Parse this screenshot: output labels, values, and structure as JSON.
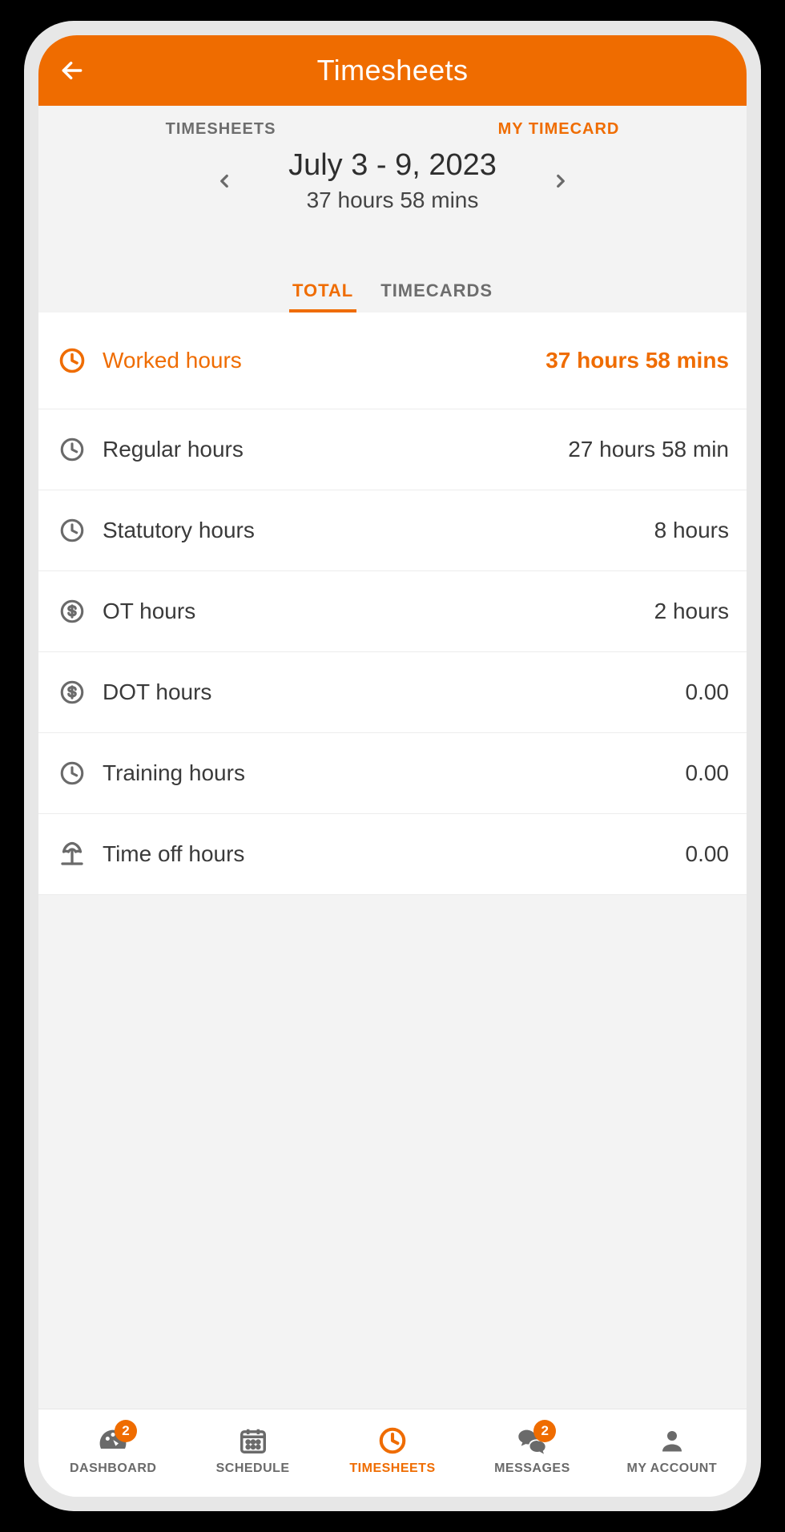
{
  "header": {
    "title": "Timesheets"
  },
  "top_tabs": {
    "timesheets": "TIMESHEETS",
    "my_timecard": "MY TIMECARD"
  },
  "date": {
    "range": "July 3 - 9, 2023",
    "summary": "37 hours 58 mins"
  },
  "subtabs": {
    "total": "TOTAL",
    "timecards": "TIMECARDS"
  },
  "rows": {
    "worked": {
      "label": "Worked hours",
      "value": "37 hours 58 mins"
    },
    "regular": {
      "label": "Regular hours",
      "value": "27 hours 58 min"
    },
    "statutory": {
      "label": "Statutory hours",
      "value": "8 hours"
    },
    "ot": {
      "label": "OT hours",
      "value": "2 hours"
    },
    "dot": {
      "label": "DOT hours",
      "value": "0.00"
    },
    "training": {
      "label": "Training hours",
      "value": "0.00"
    },
    "timeoff": {
      "label": "Time off hours",
      "value": "0.00"
    }
  },
  "nav": {
    "dashboard": {
      "label": "DASHBOARD",
      "badge": "2"
    },
    "schedule": {
      "label": "SCHEDULE"
    },
    "timesheets": {
      "label": "TIMESHEETS"
    },
    "messages": {
      "label": "MESSAGES",
      "badge": "2"
    },
    "account": {
      "label": "MY ACCOUNT"
    }
  }
}
